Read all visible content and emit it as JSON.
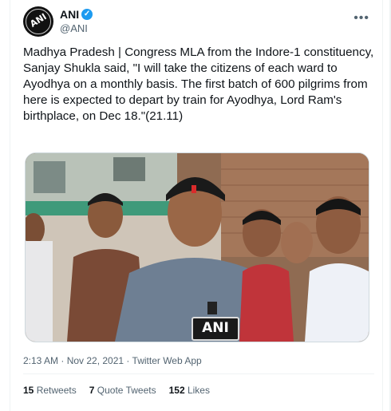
{
  "author": {
    "name": "ANI",
    "handle": "@ANI",
    "avatar_text": "ANI"
  },
  "tweet": {
    "text": "Madhya Pradesh | Congress MLA from the Indore-1 constituency, Sanjay Shukla said, \"I will take the citizens of each ward to Ayodhya on a monthly basis. The first batch of 600 pilgrims from here is expected to depart by train for Ayodhya, Lord Ram's birthplace, on Dec 18.\"(21.11)",
    "timestamp": "2:13 AM · Nov 22, 2021 · Twitter Web App"
  },
  "media": {
    "mic_label": "ANI"
  },
  "stats": {
    "retweets_count": "15",
    "retweets_label": "Retweets",
    "quotes_count": "7",
    "quotes_label": "Quote Tweets",
    "likes_count": "152",
    "likes_label": "Likes"
  },
  "icons": {
    "verified": "verified-badge-icon",
    "more": "more-options-icon"
  },
  "colors": {
    "verified": "#1d9bf0",
    "secondary_text": "#536471",
    "primary_text": "#0f1419"
  }
}
